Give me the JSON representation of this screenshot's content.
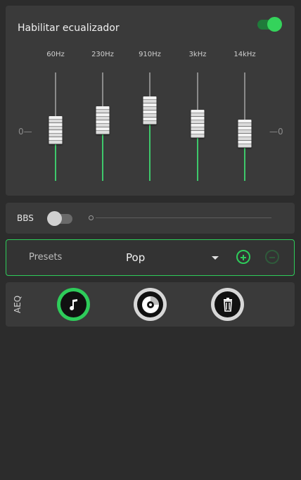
{
  "equalizer": {
    "title": "Habilitar ecualizador",
    "enabled": true,
    "zero_left": "0—",
    "zero_right": "—0",
    "bands": [
      {
        "label": "60Hz"
      },
      {
        "label": "230Hz"
      },
      {
        "label": "910Hz"
      },
      {
        "label": "3kHz"
      },
      {
        "label": "14kHz"
      }
    ]
  },
  "bbs": {
    "label": "BBS",
    "enabled": false
  },
  "presets": {
    "label": "Presets",
    "selected": "Pop"
  },
  "aeq": {
    "label": "AEQ",
    "buttons": [
      "music-icon",
      "disc-icon",
      "trash-icon"
    ]
  },
  "colors": {
    "accent": "#2ecc5a",
    "background": "#2c2c2c",
    "card": "#3a3a3a"
  }
}
